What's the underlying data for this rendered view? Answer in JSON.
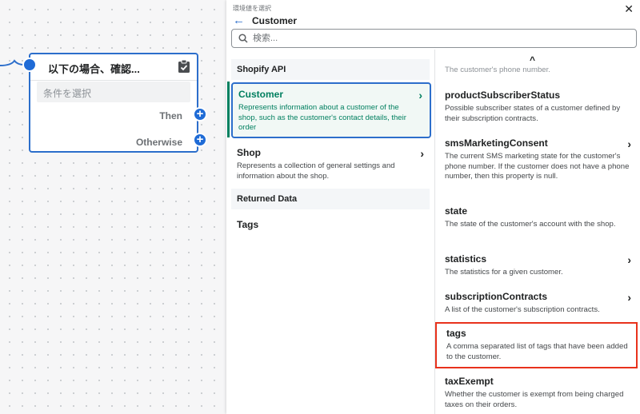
{
  "node": {
    "title": "以下の場合、確認...",
    "condition_placeholder": "条件を選択",
    "then_label": "Then",
    "otherwise_label": "Otherwise",
    "clipboard_icon": "clipboard-check-icon",
    "plus_icon": "plus-icon"
  },
  "panel": {
    "subtitle": "環境値を選択",
    "title": "Customer",
    "back_icon": "arrow-left-icon",
    "close_icon": "close-icon",
    "close_glyph": "✕",
    "back_glyph": "←",
    "search": {
      "placeholder": "検索...",
      "value": ""
    },
    "left": {
      "shopify_api_header": "Shopify API",
      "items": [
        {
          "title": "Customer",
          "description": "Represents information about a customer of the shop, such as the customer's contact details, their order",
          "selected": true,
          "has_children": true
        },
        {
          "title": "Shop",
          "description": "Represents a collection of general settings and information about the shop.",
          "selected": false,
          "has_children": true
        }
      ],
      "returned_data_header": "Returned Data",
      "tags_label": "Tags"
    },
    "right": {
      "scroll_up_glyph": "^",
      "truncated_text": "The customer's phone number.",
      "fields": [
        {
          "name": "productSubscriberStatus",
          "description": "Possible subscriber states of a customer defined by their subscription contracts.",
          "has_children": false
        },
        {
          "name": "smsMarketingConsent",
          "description": "The current SMS marketing state for the customer's phone number. If the customer does not have a phone number, then this property is null.",
          "has_children": true
        },
        {
          "name": "state",
          "description": "The state of the customer's account with the shop.",
          "has_children": false
        },
        {
          "name": "statistics",
          "description": "The statistics for a given customer.",
          "has_children": true
        },
        {
          "name": "subscriptionContracts",
          "description": "A list of the customer's subscription contracts.",
          "has_children": true
        },
        {
          "name": "tags",
          "description": "A comma separated list of tags that have been added to the customer.",
          "has_children": false,
          "highlighted": true
        },
        {
          "name": "taxExempt",
          "description": "Whether the customer is exempt from being charged taxes on their orders.",
          "has_children": false
        }
      ]
    }
  },
  "colors": {
    "accent_blue": "#2c6ecb",
    "selected_green": "#007f5f",
    "highlight_red": "#e8321c"
  }
}
